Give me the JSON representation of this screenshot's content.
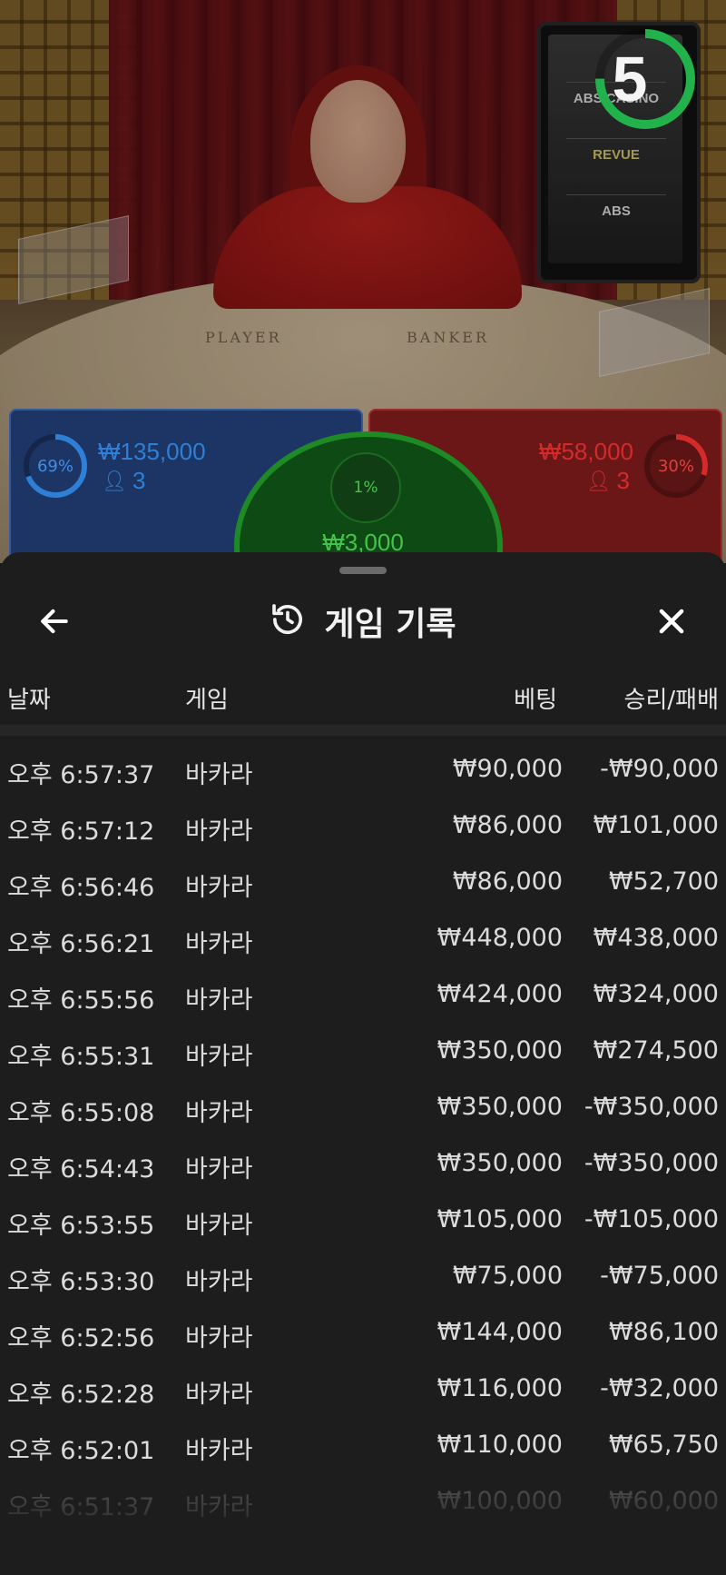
{
  "stream": {
    "table_labels": {
      "player": "PLAYER",
      "banker": "BANKER"
    },
    "timer": {
      "value": "5",
      "progress": 0.75,
      "color": "#22b24c"
    },
    "sponsors": [
      "ABS CASINO",
      "REVUE",
      "ABS"
    ]
  },
  "bets": {
    "player": {
      "percent_label": "69%",
      "percent": 0.69,
      "amount": "₩135,000",
      "players": "3",
      "color": "#2f7fd6"
    },
    "banker": {
      "percent_label": "30%",
      "percent": 0.3,
      "amount": "₩58,000",
      "players": "3",
      "color": "#d42a2a"
    },
    "tie": {
      "percent_label": "1%",
      "amount": "₩3,000",
      "color": "#45c24b"
    }
  },
  "history": {
    "title": "게임 기록",
    "columns": {
      "date": "날짜",
      "game": "게임",
      "bet": "베팅",
      "result": "승리/패배"
    },
    "rows": [
      {
        "time": "오후 6:57:37",
        "game": "바카라",
        "bet": "₩90,000",
        "result": "-₩90,000"
      },
      {
        "time": "오후 6:57:12",
        "game": "바카라",
        "bet": "₩86,000",
        "result": "₩101,000"
      },
      {
        "time": "오후 6:56:46",
        "game": "바카라",
        "bet": "₩86,000",
        "result": "₩52,700"
      },
      {
        "time": "오후 6:56:21",
        "game": "바카라",
        "bet": "₩448,000",
        "result": "₩438,000"
      },
      {
        "time": "오후 6:55:56",
        "game": "바카라",
        "bet": "₩424,000",
        "result": "₩324,000"
      },
      {
        "time": "오후 6:55:31",
        "game": "바카라",
        "bet": "₩350,000",
        "result": "₩274,500"
      },
      {
        "time": "오후 6:55:08",
        "game": "바카라",
        "bet": "₩350,000",
        "result": "-₩350,000"
      },
      {
        "time": "오후 6:54:43",
        "game": "바카라",
        "bet": "₩350,000",
        "result": "-₩350,000"
      },
      {
        "time": "오후 6:53:55",
        "game": "바카라",
        "bet": "₩105,000",
        "result": "-₩105,000"
      },
      {
        "time": "오후 6:53:30",
        "game": "바카라",
        "bet": "₩75,000",
        "result": "-₩75,000"
      },
      {
        "time": "오후 6:52:56",
        "game": "바카라",
        "bet": "₩144,000",
        "result": "₩86,100"
      },
      {
        "time": "오후 6:52:28",
        "game": "바카라",
        "bet": "₩116,000",
        "result": "-₩32,000"
      },
      {
        "time": "오후 6:52:01",
        "game": "바카라",
        "bet": "₩110,000",
        "result": "₩65,750"
      },
      {
        "time": "오후 6:51:37",
        "game": "바카라",
        "bet": "₩100,000",
        "result": "₩60,000"
      }
    ]
  }
}
